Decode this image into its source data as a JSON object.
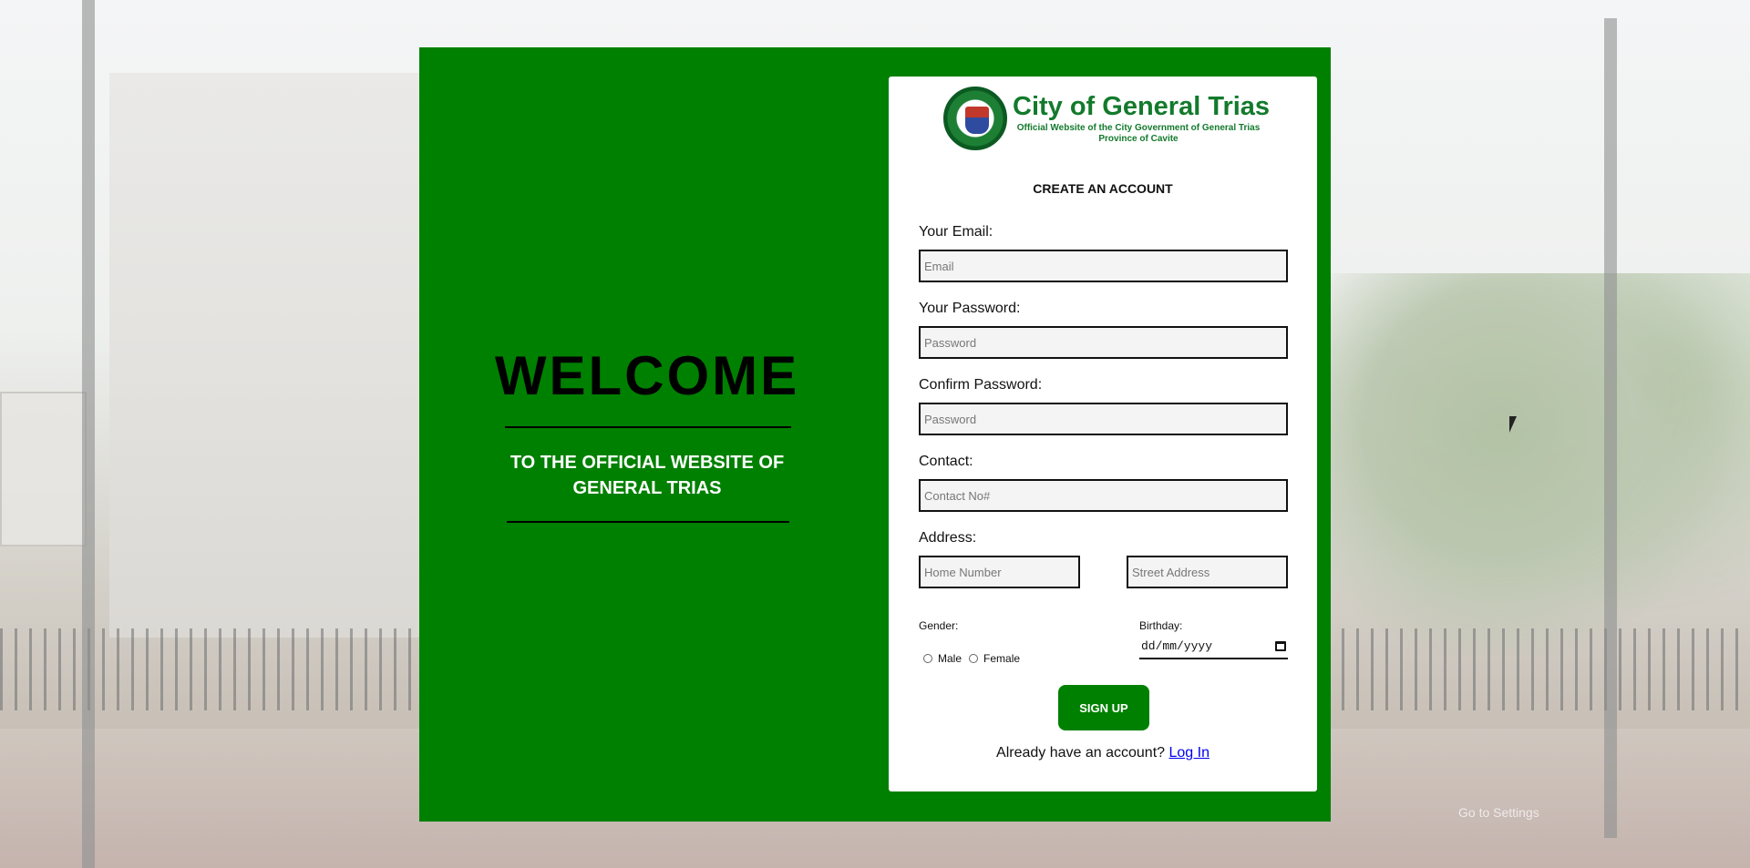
{
  "welcome": {
    "title": "WELCOME",
    "subtitle": "TO THE OFFICIAL WEBSITE OF GENERAL TRIAS"
  },
  "logo": {
    "name": "City of General Trias",
    "tagline": "Official Website of the City Government of General Trias",
    "province": "Province of Cavite",
    "seal_icon": "city-seal-icon"
  },
  "form": {
    "title": "CREATE AN ACCOUNT",
    "email": {
      "label": "Your Email:",
      "placeholder": "Email",
      "value": ""
    },
    "password": {
      "label": "Your Password:",
      "placeholder": "Password",
      "value": ""
    },
    "confirm_password": {
      "label": "Confirm Password:",
      "placeholder": "Password",
      "value": ""
    },
    "contact": {
      "label": "Contact:",
      "placeholder": "Contact No#",
      "value": ""
    },
    "address": {
      "label": "Address:",
      "home_placeholder": "Home Number",
      "street_placeholder": "Street Address"
    },
    "gender": {
      "label": "Gender:",
      "options": [
        "Male",
        "Female"
      ]
    },
    "birthday": {
      "label": "Birthday:",
      "placeholder": "dd/mm/yyyy",
      "icon": "calendar-icon"
    },
    "signup_label": "SIGN UP",
    "already_text": "Already have an account?",
    "login_label": "Log In"
  },
  "watermark": "Go to Settings",
  "colors": {
    "panel_green": "#008000",
    "logo_green": "#137a2c",
    "link_blue": "#0000ee"
  }
}
